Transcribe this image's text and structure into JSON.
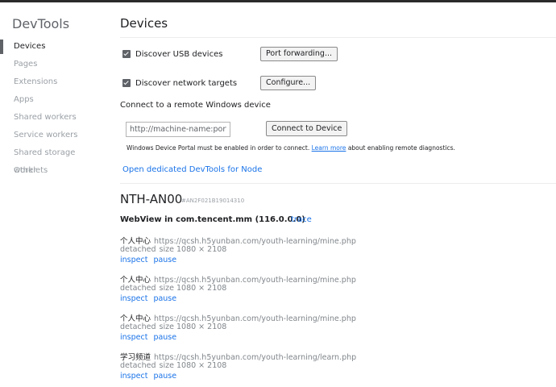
{
  "app": {
    "title": "DevTools"
  },
  "sidebar": {
    "items": [
      {
        "label": "Devices",
        "active": true
      },
      {
        "label": "Pages"
      },
      {
        "label": "Extensions"
      },
      {
        "label": "Apps"
      },
      {
        "label": "Shared workers"
      },
      {
        "label": "Service workers"
      },
      {
        "label": "Shared storage worklets"
      },
      {
        "label": "Other"
      }
    ]
  },
  "main": {
    "title": "Devices",
    "usb": {
      "label": "Discover USB devices",
      "checked": true,
      "button": "Port forwarding..."
    },
    "network": {
      "label": "Discover network targets",
      "checked": true,
      "button": "Configure..."
    },
    "remote": {
      "heading": "Connect to a remote Windows device",
      "placeholder": "http://machine-name:port",
      "button": "Connect to Device",
      "note_before": "Windows Device Portal must be enabled in order to connect.",
      "note_link": "Learn more",
      "note_after": "about enabling remote diagnostics."
    },
    "open_node_link": "Open dedicated DevTools for Node",
    "device": {
      "name": "NTH-AN00",
      "serial": "#AN2F021B19014310",
      "webview": "WebView in com.tencent.mm (116.0.0.0)",
      "trace": "trace",
      "pages": [
        {
          "title": "个人中心",
          "url": "https://qcsh.h5yunban.com/youth-learning/mine.php",
          "status": "detached",
          "size": "size 1080 × 2108",
          "inspect": "inspect",
          "pause": "pause"
        },
        {
          "title": "个人中心",
          "url": "https://qcsh.h5yunban.com/youth-learning/mine.php",
          "status": "detached",
          "size": "size 1080 × 2108",
          "inspect": "inspect",
          "pause": "pause"
        },
        {
          "title": "个人中心",
          "url": "https://qcsh.h5yunban.com/youth-learning/mine.php",
          "status": "detached",
          "size": "size 1080 × 2108",
          "inspect": "inspect",
          "pause": "pause"
        },
        {
          "title": "学习频道",
          "url": "https://qcsh.h5yunban.com/youth-learning/learn.php",
          "status": "detached",
          "size": "size 1080 × 2108",
          "inspect": "inspect",
          "pause": "pause"
        }
      ]
    }
  }
}
